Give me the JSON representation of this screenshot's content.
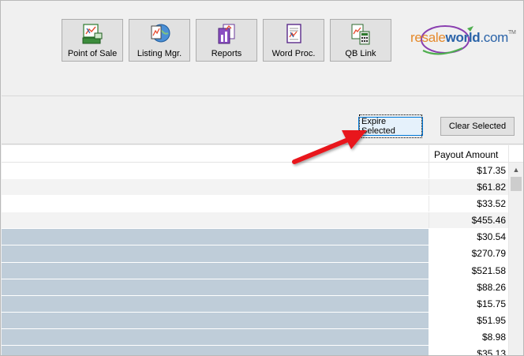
{
  "toolbar": {
    "buttons": [
      {
        "label": "Point of Sale",
        "icon": "point-of-sale-icon"
      },
      {
        "label": "Listing Mgr.",
        "icon": "listing-manager-icon"
      },
      {
        "label": "Reports",
        "icon": "reports-icon"
      },
      {
        "label": "Word Proc.",
        "icon": "word-processor-icon"
      },
      {
        "label": "QB Link",
        "icon": "quickbooks-link-icon"
      }
    ]
  },
  "logo": {
    "resale": "resale",
    "world": "world",
    "com": ".com",
    "tm": "TM"
  },
  "actions": {
    "expire_selected": "Expire Selected",
    "clear_selected": "Clear Selected"
  },
  "grid": {
    "column_header": "Payout Amount",
    "rows": [
      {
        "amount": "$17.35",
        "selected": false
      },
      {
        "amount": "$61.82",
        "selected": false
      },
      {
        "amount": "$33.52",
        "selected": false
      },
      {
        "amount": "$455.46",
        "selected": false
      },
      {
        "amount": "$30.54",
        "selected": true
      },
      {
        "amount": "$270.79",
        "selected": true
      },
      {
        "amount": "$521.58",
        "selected": true
      },
      {
        "amount": "$88.26",
        "selected": true
      },
      {
        "amount": "$15.75",
        "selected": true
      },
      {
        "amount": "$51.95",
        "selected": true
      },
      {
        "amount": "$8.98",
        "selected": true
      },
      {
        "amount": "$35.13",
        "selected": true
      }
    ]
  },
  "colors": {
    "selected_row": "#bfcdd9",
    "annotation_arrow": "#e8141b",
    "focus_border": "#0078d7"
  }
}
